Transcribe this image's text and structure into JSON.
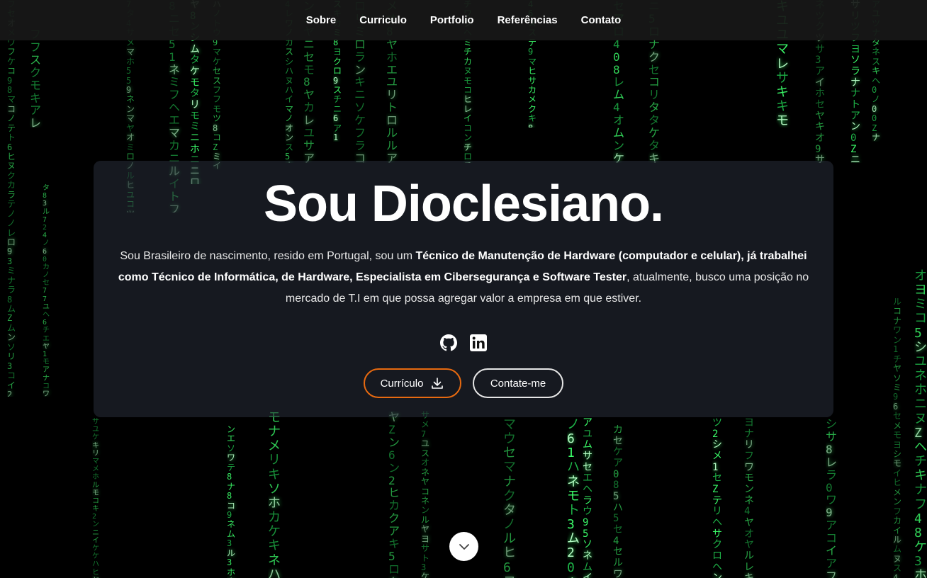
{
  "nav": {
    "items": [
      "Sobre",
      "Curriculo",
      "Portfolio",
      "Referências",
      "Contato"
    ]
  },
  "hero": {
    "title": "Sou Dioclesiano.",
    "description": {
      "intro": "Sou Brasileiro de nascimento, resido em Portugal, sou um ",
      "highlight": "Técnico de Manutenção de Hardware (computador e celular), já trabalhei como Técnico de Informática, de Hardware, Especialista em Cibersegurança e Software Tester",
      "outro": ", atualmente, busco uma posição no mercado de T.I em que possa agregar valor a empresa em que estiver."
    },
    "social": [
      {
        "name": "github-icon"
      },
      {
        "name": "linkedin-icon"
      }
    ],
    "buttons": {
      "cv_label": "Currículo",
      "contact_label": "Contate-me"
    }
  },
  "scroll": {
    "icon": "chevron-down-icon"
  },
  "colors": {
    "matrix_green": "#3cff6b",
    "accent_orange": "#e86a10",
    "background": "#000000"
  }
}
